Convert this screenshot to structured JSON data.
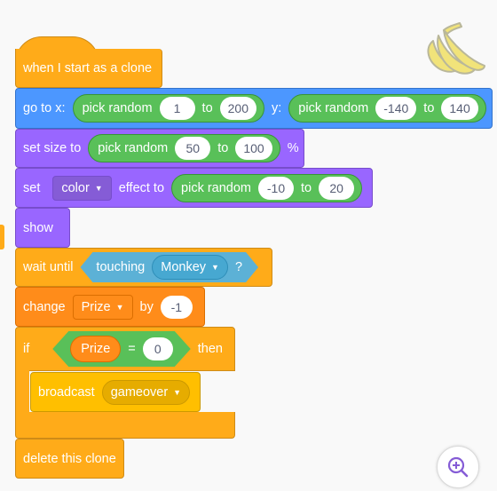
{
  "script": {
    "hat": {
      "label": "when I start as a clone"
    },
    "goto": {
      "label": "go to x:",
      "x_reporter": {
        "label": "pick random",
        "from": "1",
        "to_word": "to",
        "to": "200"
      },
      "y_label": "y:",
      "y_reporter": {
        "label": "pick random",
        "from": "-140",
        "to_word": "to",
        "to": "140"
      }
    },
    "set_size": {
      "label": "set size to",
      "reporter": {
        "label": "pick random",
        "from": "50",
        "to_word": "to",
        "to": "100"
      },
      "suffix": "%"
    },
    "set_effect": {
      "label": "set",
      "effect": "color",
      "mid": "effect to",
      "reporter": {
        "label": "pick random",
        "from": "-10",
        "to_word": "to",
        "to": "20"
      }
    },
    "show": {
      "label": "show"
    },
    "wait_until": {
      "label": "wait until",
      "condition": {
        "label": "touching",
        "target": "Monkey",
        "suffix": "?"
      }
    },
    "change_var": {
      "label": "change",
      "variable": "Prize",
      "mid": "by",
      "value": "-1"
    },
    "if_block": {
      "label": "if",
      "condition": {
        "left": "Prize",
        "op": "=",
        "right": "0"
      },
      "then_label": "then"
    },
    "broadcast": {
      "label": "broadcast",
      "message": "gameover"
    },
    "delete_clone": {
      "label": "delete this clone"
    }
  },
  "sprite_icon": "banana-icon",
  "zoom_icon": "zoom-in-icon",
  "colors": {
    "events": "#ffab19",
    "motion": "#4c97ff",
    "looks": "#9966ff",
    "operators": "#59c059",
    "sensing": "#5cb1d6",
    "variables": "#ff8c1a",
    "control": "#ffab19",
    "background": "#f9f9f9"
  }
}
